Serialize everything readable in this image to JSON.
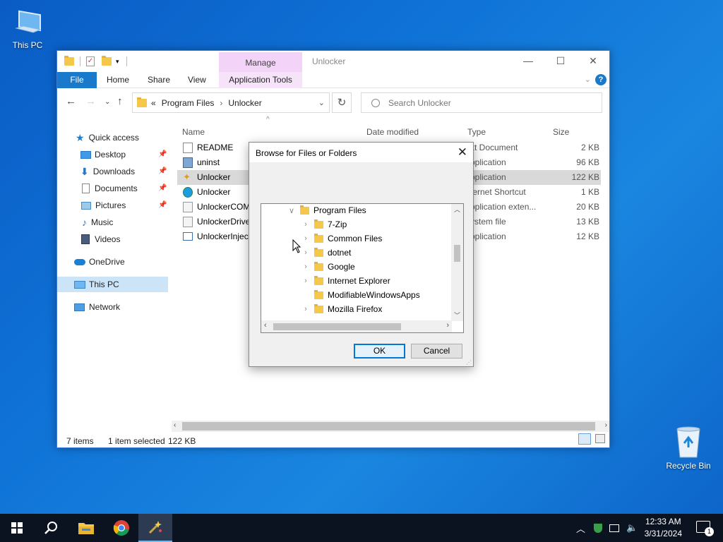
{
  "desktop": {
    "icons": [
      {
        "label": "This PC",
        "icon": "this-pc-icon"
      },
      {
        "label": "Recycle Bin",
        "icon": "recycle-bin-icon"
      }
    ]
  },
  "explorer": {
    "title": "Unlocker",
    "manage_tab": "Manage",
    "ribbon_tabs": [
      "File",
      "Home",
      "Share",
      "View",
      "Application Tools"
    ],
    "address": {
      "prefix": "«",
      "crumbs": [
        "Program Files",
        "Unlocker"
      ]
    },
    "search_placeholder": "Search Unlocker",
    "sidebar": [
      {
        "label": "Quick access",
        "icon": "star-icon"
      },
      {
        "label": "Desktop",
        "icon": "desktop-folder-icon",
        "pinned": true
      },
      {
        "label": "Downloads",
        "icon": "download-arrow-icon",
        "pinned": true
      },
      {
        "label": "Documents",
        "icon": "documents-icon",
        "pinned": true
      },
      {
        "label": "Pictures",
        "icon": "pictures-icon",
        "pinned": true
      },
      {
        "label": "Music",
        "icon": "music-note-icon"
      },
      {
        "label": "Videos",
        "icon": "videos-icon"
      },
      {
        "label": "OneDrive",
        "icon": "cloud-icon"
      },
      {
        "label": "This PC",
        "icon": "computer-icon",
        "selected": true
      },
      {
        "label": "Network",
        "icon": "network-icon"
      }
    ],
    "columns": [
      "Name",
      "Date modified",
      "Type",
      "Size"
    ],
    "files": [
      {
        "name": "README",
        "type": "xt Document",
        "size": "2 KB",
        "icon": "text-file-icon"
      },
      {
        "name": "uninst",
        "type": "pplication",
        "size": "96 KB",
        "icon": "installer-icon"
      },
      {
        "name": "Unlocker",
        "type": "pplication",
        "size": "122 KB",
        "icon": "unlocker-wand-icon",
        "selected": true
      },
      {
        "name": "Unlocker",
        "type": "ternet Shortcut",
        "size": "1 KB",
        "icon": "internet-shortcut-icon"
      },
      {
        "name": "UnlockerCOM",
        "type": "pplication exten...",
        "size": "20 KB",
        "icon": "dll-file-icon"
      },
      {
        "name": "UnlockerDrive",
        "type": "ystem file",
        "size": "13 KB",
        "icon": "system-file-icon"
      },
      {
        "name": "UnlockerInject",
        "type": "pplication",
        "size": "12 KB",
        "icon": "application-file-icon"
      }
    ],
    "status": {
      "items": "7 items",
      "selected": "1 item selected",
      "size": "122 KB"
    }
  },
  "dialog": {
    "title": "Browse for Files or Folders",
    "tree": [
      {
        "label": "Program Files",
        "level": 0,
        "expanded": true
      },
      {
        "label": "7-Zip",
        "level": 1,
        "has_children": true
      },
      {
        "label": "Common Files",
        "level": 1,
        "has_children": true
      },
      {
        "label": "dotnet",
        "level": 1,
        "has_children": true
      },
      {
        "label": "Google",
        "level": 1,
        "has_children": true
      },
      {
        "label": "Internet Explorer",
        "level": 1,
        "has_children": true
      },
      {
        "label": "ModifiableWindowsApps",
        "level": 1,
        "has_children": false
      },
      {
        "label": "Mozilla Firefox",
        "level": 1,
        "has_children": true
      }
    ],
    "ok_label": "OK",
    "cancel_label": "Cancel"
  },
  "taskbar": {
    "apps": [
      "start-windows-icon",
      "search-icon",
      "file-explorer-icon",
      "chrome-icon",
      "unlocker-wand-icon"
    ],
    "time": "12:33 AM",
    "date": "3/31/2024",
    "notification_count": "1"
  }
}
